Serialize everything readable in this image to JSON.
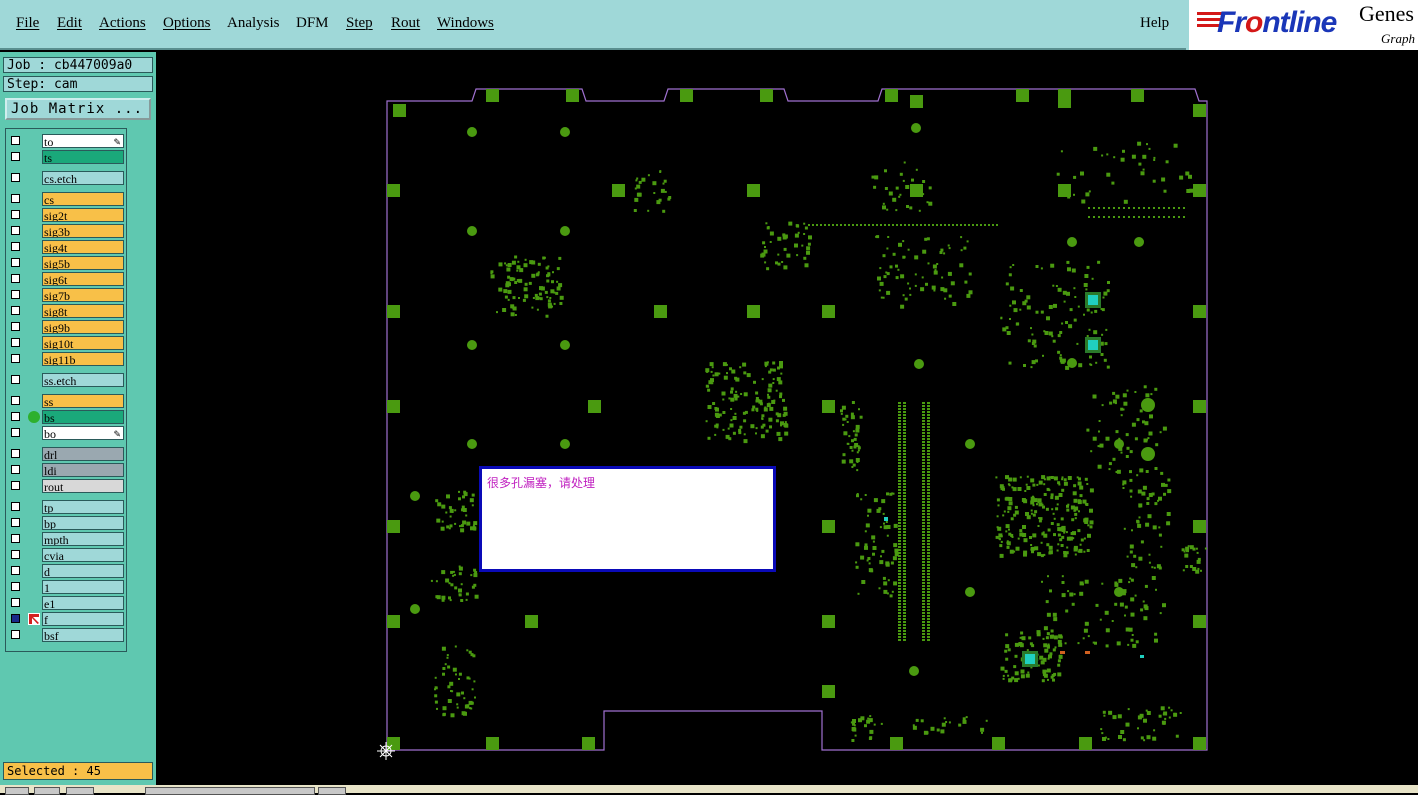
{
  "menu": {
    "items": [
      {
        "label": "File"
      },
      {
        "label": "Edit"
      },
      {
        "label": "Actions"
      },
      {
        "label": "Options"
      },
      {
        "label": "Analysis"
      },
      {
        "label": "DFM"
      },
      {
        "label": "Step"
      },
      {
        "label": "Rout"
      },
      {
        "label": "Windows"
      }
    ],
    "help": "Help"
  },
  "brand": {
    "logo_text": "Frontline",
    "product": "Genes",
    "tagline": "Graph"
  },
  "job": {
    "job_label": "Job : cb447009a0",
    "step_label": "Step: cam"
  },
  "job_matrix_button": "Job Matrix ...",
  "layers": [
    {
      "name": "to",
      "style": "white",
      "pen": true
    },
    {
      "name": "ts",
      "style": "teal"
    },
    {
      "name": "cs.etch",
      "style": "cyan"
    },
    {
      "name": "cs",
      "style": "orange"
    },
    {
      "name": "sig2t",
      "style": "orange"
    },
    {
      "name": "sig3b",
      "style": "orange"
    },
    {
      "name": "sig4t",
      "style": "orange"
    },
    {
      "name": "sig5b",
      "style": "orange"
    },
    {
      "name": "sig6t",
      "style": "orange"
    },
    {
      "name": "sig7b",
      "style": "orange"
    },
    {
      "name": "sig8t",
      "style": "orange"
    },
    {
      "name": "sig9b",
      "style": "orange"
    },
    {
      "name": "sig10t",
      "style": "orange"
    },
    {
      "name": "sig11b",
      "style": "orange"
    },
    {
      "name": "ss.etch",
      "style": "cyan"
    },
    {
      "name": "ss",
      "style": "orange"
    },
    {
      "name": "bs",
      "style": "teal",
      "dot": true
    },
    {
      "name": "bo",
      "style": "white",
      "pen": true
    },
    {
      "name": "drl",
      "style": "gray"
    },
    {
      "name": "ldi",
      "style": "gray"
    },
    {
      "name": "rout",
      "style": "lightgray"
    },
    {
      "name": "tp",
      "style": "cyan"
    },
    {
      "name": "bp",
      "style": "cyan"
    },
    {
      "name": "mpth",
      "style": "cyan"
    },
    {
      "name": "cvia",
      "style": "cyan"
    },
    {
      "name": "d",
      "style": "cyan"
    },
    {
      "name": "1",
      "style": "cyan"
    },
    {
      "name": "e1",
      "style": "cyan"
    },
    {
      "name": "f",
      "style": "cyan",
      "work": true
    },
    {
      "name": "bsf",
      "style": "cyan"
    }
  ],
  "status": {
    "selected": "Selected : 45"
  },
  "message": {
    "text": "很多孔漏塞，请处理"
  },
  "colors": {
    "pad_green": "#4a9a10",
    "outline_purple": "#a070d0",
    "highlight_cyan": "#20d0c0"
  }
}
